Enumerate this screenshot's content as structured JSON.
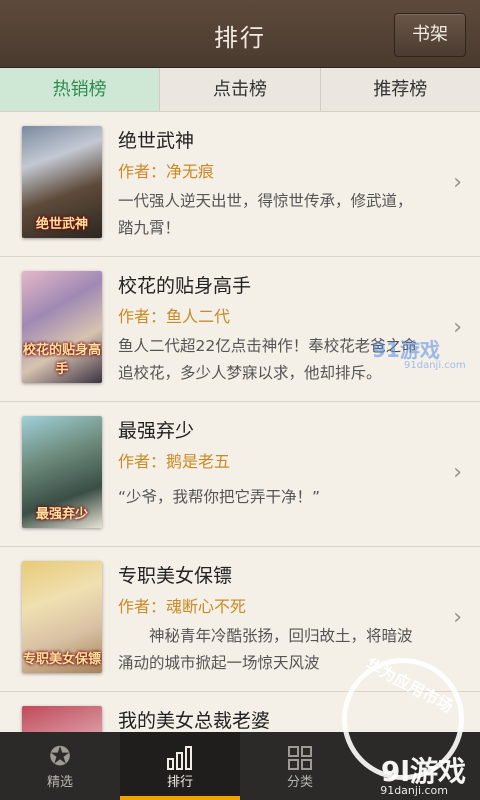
{
  "header": {
    "title": "排行",
    "shelf_button": "书架"
  },
  "tabs": [
    {
      "label": "热销榜",
      "active": true
    },
    {
      "label": "点击榜",
      "active": false
    },
    {
      "label": "推荐榜",
      "active": false
    }
  ],
  "books": [
    {
      "title": "绝世武神",
      "author": "作者：净无痕",
      "description": "一代强人逆天出世，得惊世传承，修武道，踏九霄！",
      "cover_text": "绝世武神"
    },
    {
      "title": "校花的贴身高手",
      "author": "作者：鱼人二代",
      "description": "鱼人二代超22亿点击神作！奉校花老爸之命追校花，多少人梦寐以求，他却排斥。",
      "cover_text": "校花的贴身高手"
    },
    {
      "title": "最强弃少",
      "author": "作者：鹅是老五",
      "description": "“少爷，我帮你把它弄干净！”",
      "cover_text": "最强弃少"
    },
    {
      "title": "专职美女保镖",
      "author": "作者：魂断心不死",
      "description": "　　神秘青年冷酷张扬，回归故土，将暗波涌动的城市掀起一场惊天风波",
      "cover_text": "专职美女保镖"
    },
    {
      "title": "我的美女总裁老婆",
      "author": "",
      "description": "",
      "cover_text": ""
    }
  ],
  "bottom_nav": [
    {
      "label": "精选",
      "icon": "medal-icon",
      "active": false
    },
    {
      "label": "排行",
      "icon": "bar-chart-icon",
      "active": true
    },
    {
      "label": "分类",
      "icon": "grid-icon",
      "active": false
    },
    {
      "label": "",
      "icon": "more-icon",
      "active": false
    }
  ],
  "watermark": {
    "brand": "9l游戏",
    "url": "91danji.com",
    "circle_text": "华为应用市场",
    "mid_brand": "91游戏",
    "mid_url": "91danji.com"
  }
}
